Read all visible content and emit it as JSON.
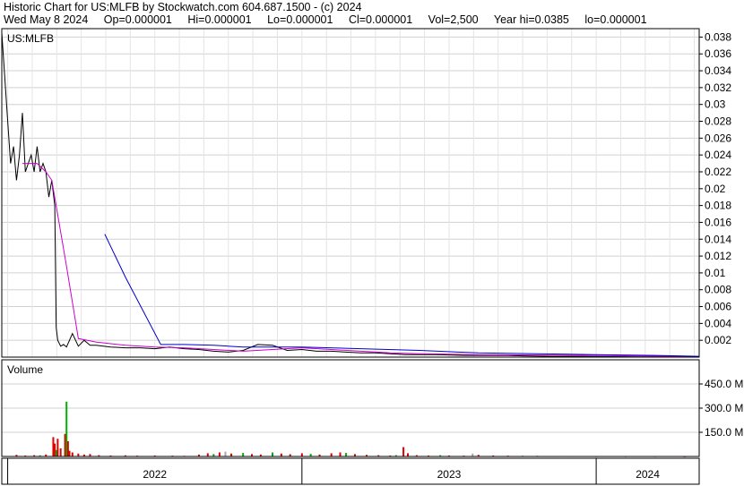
{
  "header": {
    "title": "Historic Chart for US:MLFB by Stockwatch.com 604.687.1500 - (c) 2024",
    "date": "Wed May  8 2024",
    "open": "Op=0.000001",
    "high": "Hi=0.000001",
    "low": "Lo=0.000001",
    "close": "Cl=0.000001",
    "volume": "Vol=2,500",
    "year_high": "Year hi=0.0385",
    "year_low": "lo=0.000001"
  },
  "chart_data": [
    {
      "type": "line",
      "title": "US:MLFB",
      "xlabel": "",
      "ylabel": "",
      "ylim": [
        0,
        0.039
      ],
      "y_ticks": [
        "0.038",
        "0.036",
        "0.034",
        "0.032",
        "0.03",
        "0.028",
        "0.026",
        "0.024",
        "0.022",
        "0.02",
        "0.018",
        "0.016",
        "0.014",
        "0.012",
        "0.01",
        "0.008",
        "0.006",
        "0.004",
        "0.002"
      ],
      "x_ticks": [
        "2022",
        "2023",
        "2024"
      ],
      "grid": true,
      "series": [
        {
          "color": "#000000",
          "t": [
            2021.98,
            2022.0,
            2022.01,
            2022.02,
            2022.03,
            2022.04,
            2022.05,
            2022.06,
            2022.07,
            2022.08,
            2022.09,
            2022.1,
            2022.11,
            2022.12,
            2022.13,
            2022.14,
            2022.15,
            2022.16,
            2022.165,
            2022.17,
            2022.18,
            2022.19,
            2022.2,
            2022.22,
            2022.24,
            2022.26,
            2022.28,
            2022.3,
            2022.35,
            2022.4,
            2022.45,
            2022.5,
            2022.55,
            2022.6,
            2022.65,
            2022.7,
            2022.75,
            2022.8,
            2022.85,
            2022.9,
            2022.95,
            2023.0,
            2023.05,
            2023.1,
            2023.15,
            2023.2,
            2023.25,
            2023.3,
            2023.35,
            2023.4,
            2023.45,
            2023.5,
            2023.55,
            2023.6,
            2023.65,
            2023.7,
            2023.75,
            2023.8,
            2023.85,
            2023.9,
            2023.95,
            2024.0,
            2024.05,
            2024.1,
            2024.15,
            2024.2,
            2024.25,
            2024.3,
            2024.35
          ],
          "y": [
            0.0385,
            0.028,
            0.023,
            0.025,
            0.021,
            0.024,
            0.029,
            0.022,
            0.023,
            0.024,
            0.022,
            0.025,
            0.022,
            0.023,
            0.022,
            0.019,
            0.021,
            0.018,
            0.0035,
            0.002,
            0.0013,
            0.0015,
            0.0012,
            0.0028,
            0.0013,
            0.002,
            0.0014,
            0.0014,
            0.0012,
            0.0011,
            0.0011,
            0.001,
            0.0012,
            0.001,
            0.0009,
            0.0007,
            0.0006,
            0.0008,
            0.0015,
            0.0014,
            0.0008,
            0.0009,
            0.0007,
            0.0007,
            0.0006,
            0.0005,
            0.0005,
            0.0004,
            0.0003,
            0.0003,
            0.0003,
            0.00025,
            0.0002,
            0.0002,
            0.0002,
            0.0002,
            0.00015,
            0.00012,
            0.0001,
            0.0001,
            8e-05,
            6e-05,
            5e-05,
            4e-05,
            3e-05,
            2e-05,
            1.5e-05,
            1e-05,
            1e-06
          ]
        },
        {
          "color": "#cc00cc",
          "t": [
            2022.05,
            2022.1,
            2022.13,
            2022.15,
            2022.2,
            2022.24,
            2022.3,
            2022.4,
            2022.5,
            2022.6,
            2022.7,
            2022.8,
            2022.9,
            2023.0,
            2023.1,
            2023.2,
            2023.3,
            2023.4,
            2023.6,
            2023.8,
            2024.0,
            2024.2,
            2024.35
          ],
          "y": [
            0.023,
            0.023,
            0.022,
            0.021,
            0.0108,
            0.0022,
            0.0018,
            0.0014,
            0.0012,
            0.0011,
            0.0009,
            0.0007,
            0.0009,
            0.0011,
            0.0009,
            0.0007,
            0.0005,
            0.0004,
            0.0003,
            0.00025,
            0.0002,
            0.00012,
            5e-05
          ]
        },
        {
          "color": "#0000cc",
          "t": [
            2022.33,
            2022.4,
            2022.52,
            2022.6,
            2022.7,
            2022.8,
            2023.0,
            2023.2,
            2023.4,
            2023.6,
            2023.8,
            2024.0,
            2024.2,
            2024.35
          ],
          "y": [
            0.0146,
            0.0095,
            0.0015,
            0.0015,
            0.0014,
            0.0012,
            0.0012,
            0.001,
            0.0008,
            0.0005,
            0.0004,
            0.0003,
            0.0002,
            0.0001
          ]
        }
      ]
    },
    {
      "type": "bar",
      "title": "Volume",
      "y_ticks": [
        "450.0 M",
        "300.0 M",
        "150.0 M"
      ],
      "ylim": [
        0,
        600
      ],
      "bars": [
        {
          "t": 2022.03,
          "v": 10,
          "c": "#e00000"
        },
        {
          "t": 2022.06,
          "v": 6,
          "c": "#e00000"
        },
        {
          "t": 2022.09,
          "v": 8,
          "c": "#e00000"
        },
        {
          "t": 2022.11,
          "v": 7,
          "c": "#00b000"
        },
        {
          "t": 2022.13,
          "v": 12,
          "c": "#e00000"
        },
        {
          "t": 2022.155,
          "v": 120,
          "c": "#e00000"
        },
        {
          "t": 2022.16,
          "v": 80,
          "c": "#e00000"
        },
        {
          "t": 2022.165,
          "v": 40,
          "c": "#00b000"
        },
        {
          "t": 2022.17,
          "v": 110,
          "c": "#e00000"
        },
        {
          "t": 2022.18,
          "v": 50,
          "c": "#e00000"
        },
        {
          "t": 2022.195,
          "v": 140,
          "c": "#e00000"
        },
        {
          "t": 2022.2,
          "v": 340,
          "c": "#00b000"
        },
        {
          "t": 2022.205,
          "v": 95,
          "c": "#e00000"
        },
        {
          "t": 2022.21,
          "v": 35,
          "c": "#e00000"
        },
        {
          "t": 2022.22,
          "v": 25,
          "c": "#e00000"
        },
        {
          "t": 2022.24,
          "v": 18,
          "c": "#e00000"
        },
        {
          "t": 2022.26,
          "v": 12,
          "c": "#e00000"
        },
        {
          "t": 2022.28,
          "v": 15,
          "c": "#e00000"
        },
        {
          "t": 2022.31,
          "v": 8,
          "c": "#e00000"
        },
        {
          "t": 2022.35,
          "v": 6,
          "c": "#e00000"
        },
        {
          "t": 2022.4,
          "v": 7,
          "c": "#e00000"
        },
        {
          "t": 2022.44,
          "v": 5,
          "c": "#e00000"
        },
        {
          "t": 2022.5,
          "v": 6,
          "c": "#e00000"
        },
        {
          "t": 2022.56,
          "v": 5,
          "c": "#e00000"
        },
        {
          "t": 2022.6,
          "v": 4,
          "c": "#e00000"
        },
        {
          "t": 2022.65,
          "v": 12,
          "c": "#e00000"
        },
        {
          "t": 2022.68,
          "v": 20,
          "c": "#e00000"
        },
        {
          "t": 2022.7,
          "v": 15,
          "c": "#00b000"
        },
        {
          "t": 2022.72,
          "v": 25,
          "c": "#e00000"
        },
        {
          "t": 2022.74,
          "v": 30,
          "c": "#aaaaaa"
        },
        {
          "t": 2022.76,
          "v": 18,
          "c": "#e00000"
        },
        {
          "t": 2022.8,
          "v": 22,
          "c": "#00b000"
        },
        {
          "t": 2022.83,
          "v": 15,
          "c": "#e00000"
        },
        {
          "t": 2022.86,
          "v": 12,
          "c": "#e00000"
        },
        {
          "t": 2022.9,
          "v": 25,
          "c": "#00b000"
        },
        {
          "t": 2022.93,
          "v": 18,
          "c": "#e00000"
        },
        {
          "t": 2022.96,
          "v": 14,
          "c": "#e00000"
        },
        {
          "t": 2023.0,
          "v": 20,
          "c": "#e00000"
        },
        {
          "t": 2023.03,
          "v": 16,
          "c": "#00b000"
        },
        {
          "t": 2023.06,
          "v": 12,
          "c": "#e00000"
        },
        {
          "t": 2023.1,
          "v": 20,
          "c": "#e00000"
        },
        {
          "t": 2023.13,
          "v": 25,
          "c": "#e00000"
        },
        {
          "t": 2023.15,
          "v": 22,
          "c": "#00b000"
        },
        {
          "t": 2023.18,
          "v": 15,
          "c": "#e00000"
        },
        {
          "t": 2023.22,
          "v": 10,
          "c": "#e00000"
        },
        {
          "t": 2023.26,
          "v": 8,
          "c": "#e00000"
        },
        {
          "t": 2023.3,
          "v": 6,
          "c": "#e00000"
        },
        {
          "t": 2023.32,
          "v": 8,
          "c": "#00b000"
        },
        {
          "t": 2023.345,
          "v": 58,
          "c": "#e00000"
        },
        {
          "t": 2023.36,
          "v": 20,
          "c": "#e00000"
        },
        {
          "t": 2023.39,
          "v": 8,
          "c": "#e00000"
        },
        {
          "t": 2023.43,
          "v": 6,
          "c": "#e00000"
        },
        {
          "t": 2023.47,
          "v": 8,
          "c": "#00b000"
        },
        {
          "t": 2023.5,
          "v": 6,
          "c": "#e00000"
        },
        {
          "t": 2023.55,
          "v": 5,
          "c": "#e00000"
        },
        {
          "t": 2023.58,
          "v": 18,
          "c": "#aaaaaa"
        },
        {
          "t": 2023.6,
          "v": 10,
          "c": "#e00000"
        },
        {
          "t": 2023.65,
          "v": 6,
          "c": "#e00000"
        },
        {
          "t": 2023.7,
          "v": 5,
          "c": "#e00000"
        },
        {
          "t": 2023.75,
          "v": 4,
          "c": "#e00000"
        },
        {
          "t": 2023.8,
          "v": 4,
          "c": "#e00000"
        },
        {
          "t": 2023.85,
          "v": 3,
          "c": "#e00000"
        },
        {
          "t": 2023.9,
          "v": 3,
          "c": "#e00000"
        },
        {
          "t": 2024.0,
          "v": 2,
          "c": "#e00000"
        },
        {
          "t": 2024.1,
          "v": 2,
          "c": "#e00000"
        },
        {
          "t": 2024.2,
          "v": 2,
          "c": "#e00000"
        },
        {
          "t": 2024.3,
          "v": 1,
          "c": "#e00000"
        }
      ]
    }
  ]
}
